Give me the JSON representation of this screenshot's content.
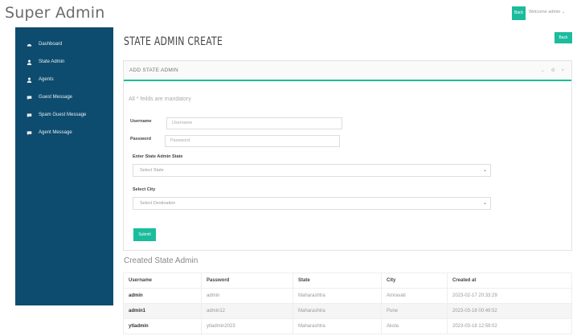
{
  "header": {
    "brand": "Super Admin",
    "back_label": "Back",
    "welcome": "Welcome admin ⌄"
  },
  "sidebar": {
    "items": [
      {
        "label": "Dashboard",
        "icon": "gauge-icon"
      },
      {
        "label": "State Admin",
        "icon": "user-icon"
      },
      {
        "label": "Agents",
        "icon": "users-icon"
      },
      {
        "label": "Guest Message",
        "icon": "message-icon"
      },
      {
        "label": "Spam Guest Message",
        "icon": "message-icon"
      },
      {
        "label": "Agent Message",
        "icon": "message-icon"
      }
    ]
  },
  "page": {
    "title": "STATE ADMIN CREATE",
    "back_label": "Back"
  },
  "form": {
    "panel_title": "ADD STATE ADMIN",
    "panel_tools": "⌄ ⚙ ×",
    "mandatory_note": "All * feilds are mandatory",
    "username_label": "Username",
    "username_placeholder": "Username",
    "password_label": "Password",
    "password_placeholder": "Password",
    "state_label": "Enter State Admin State",
    "state_selected": "Select State",
    "city_label": "Select City",
    "city_selected": "Select Destination",
    "submit_label": "Submit"
  },
  "created": {
    "title": "Created State Admin",
    "columns": [
      "Username",
      "Password",
      "State",
      "City",
      "Created at"
    ],
    "rows": [
      [
        "admin",
        "admin",
        "Maharashtra",
        "Amravati",
        "2023-02-17 20:33:29"
      ],
      [
        "admin1",
        "admin12",
        "Maharashtra",
        "Pune",
        "2023-03-18 00:49:52"
      ],
      [
        "ytladmin",
        "ytladmin2023",
        "Maharashtra",
        "Akola",
        "2023-03-18 12:59:02"
      ]
    ]
  },
  "colors": {
    "accent": "#1abc9c",
    "sidebar": "#0d4c6e"
  }
}
